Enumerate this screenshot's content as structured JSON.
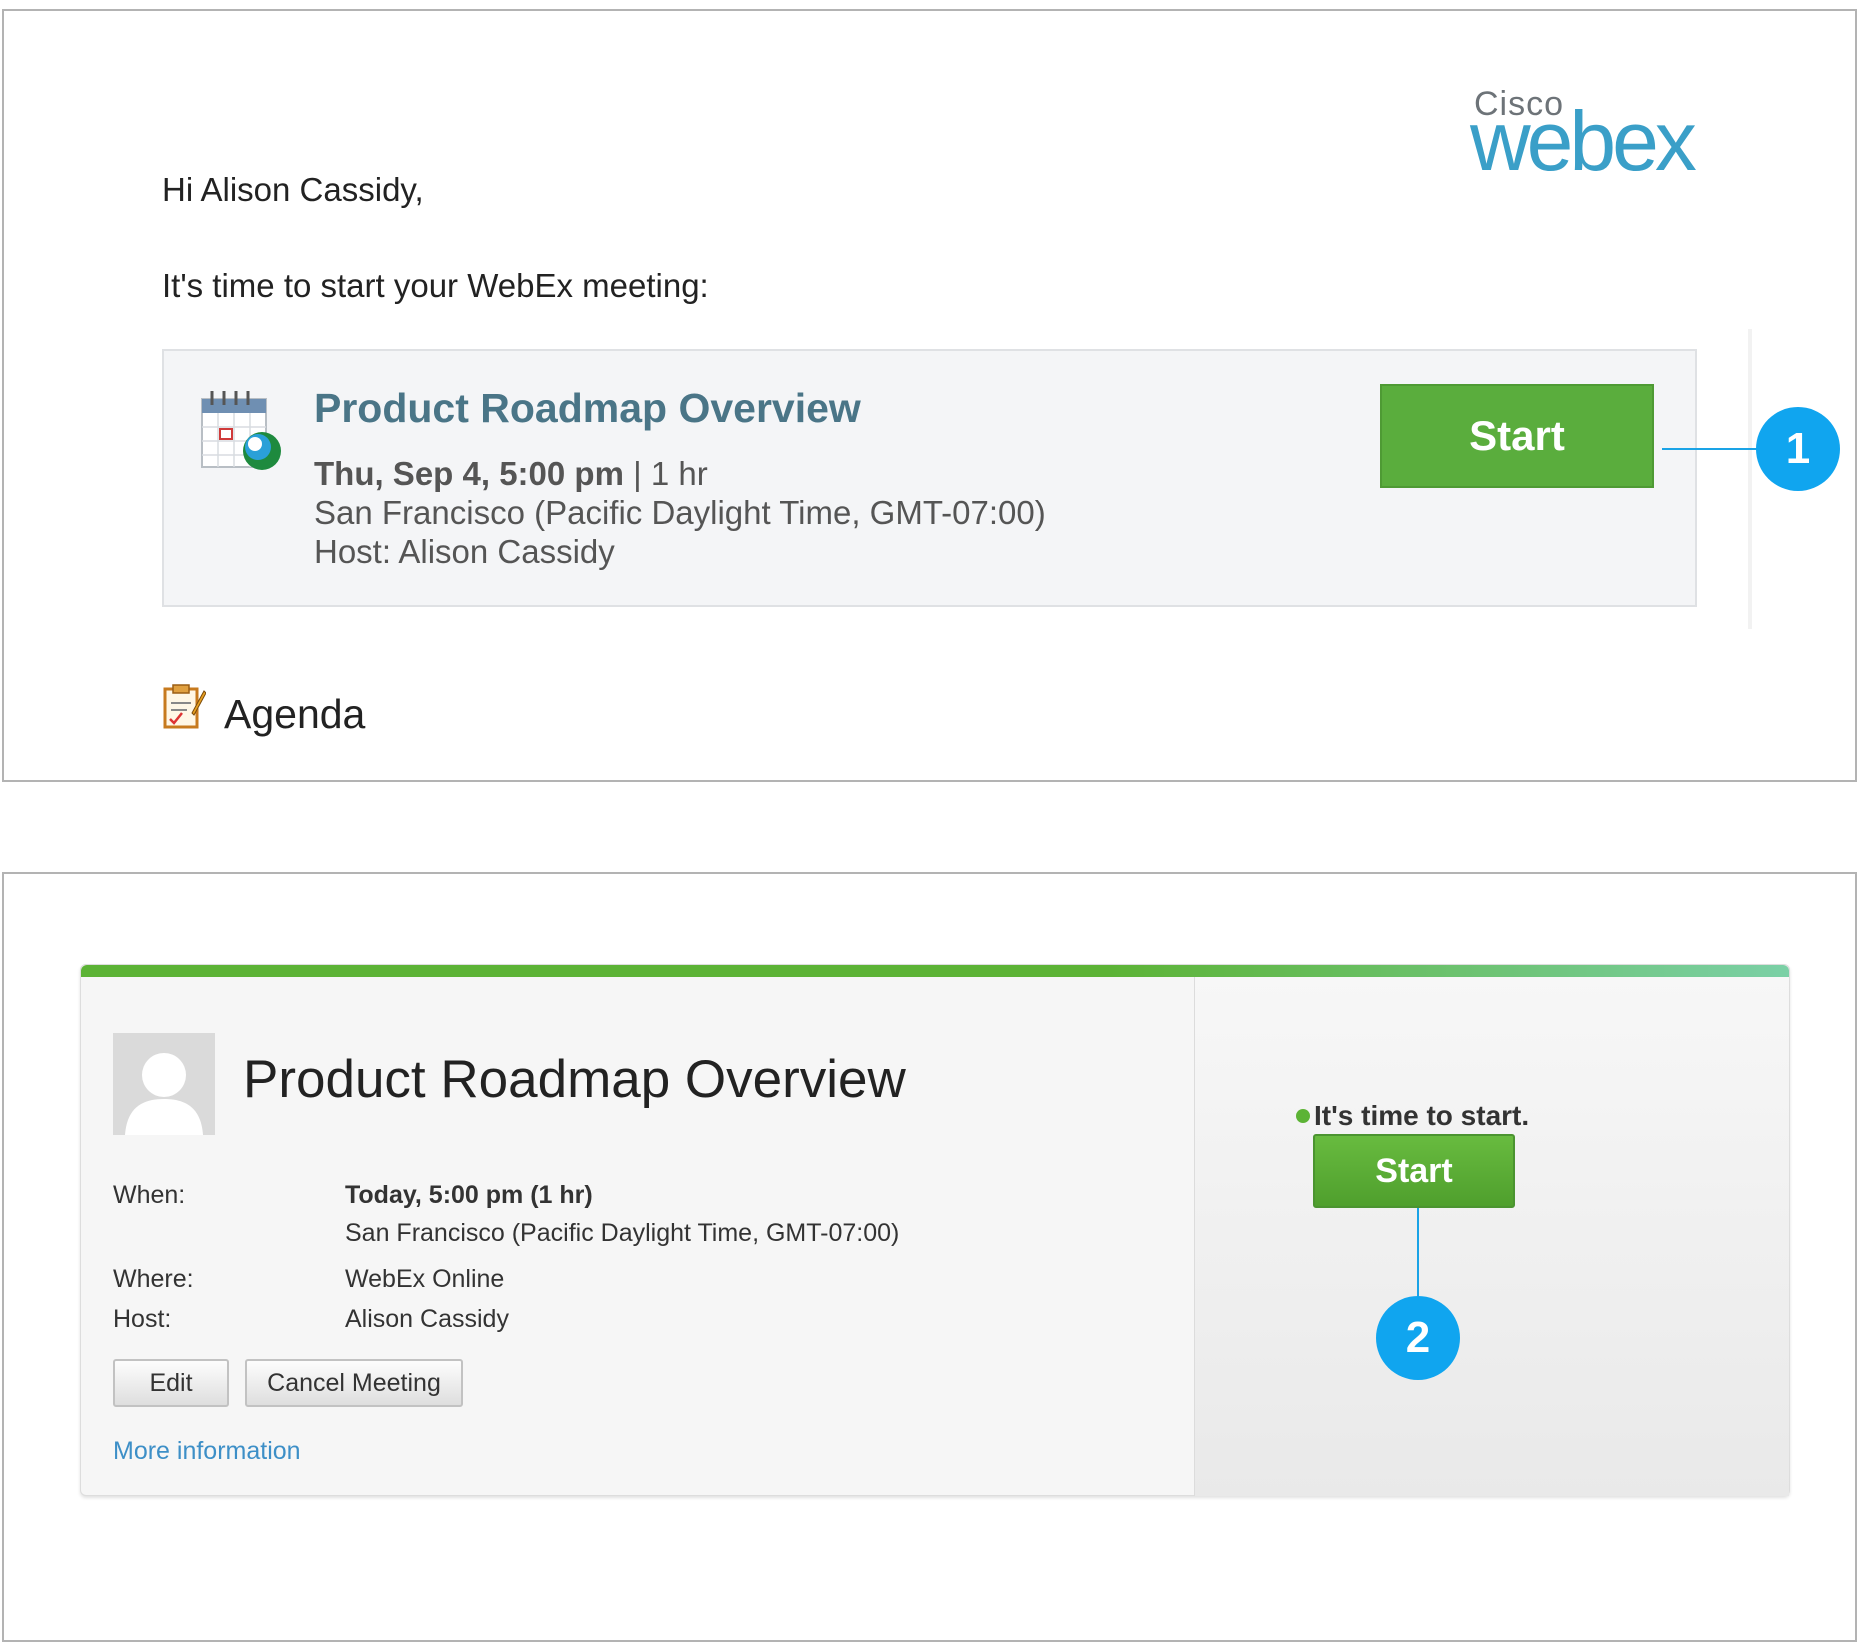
{
  "email": {
    "logo": {
      "brand_top": "Cisco",
      "brand_main": "webex"
    },
    "greeting": "Hi Alison Cassidy,",
    "intro": "It's time to start your WebEx meeting:",
    "meeting": {
      "title": "Product Roadmap Overview",
      "date": "Thu, Sep 4, 5:00 pm",
      "duration": " | 1 hr",
      "timezone": "San Francisco (Pacific Daylight Time, GMT-07:00)",
      "host": "Host: Alison Cassidy"
    },
    "start_label": "Start",
    "agenda_label": "Agenda"
  },
  "callouts": {
    "one": "1",
    "two": "2"
  },
  "web": {
    "title": "Product Roadmap Overview",
    "when_label": "When:",
    "when_value": "Today, 5:00 pm  (1 hr)",
    "when_tz": "San Francisco (Pacific Daylight Time, GMT-07:00)",
    "where_label": "Where:",
    "where_value": "WebEx Online",
    "host_label": "Host:",
    "host_value": "Alison Cassidy",
    "edit_label": "Edit",
    "cancel_label": "Cancel Meeting",
    "more_label": "More information",
    "status_text": "It's time to start.",
    "start_label": "Start"
  },
  "colors": {
    "brand_blue": "#3a9fc8",
    "start_green": "#5aad3d",
    "callout_blue": "#10a5ef",
    "title_slate": "#4a7587",
    "link_blue": "#3d8fc7"
  }
}
